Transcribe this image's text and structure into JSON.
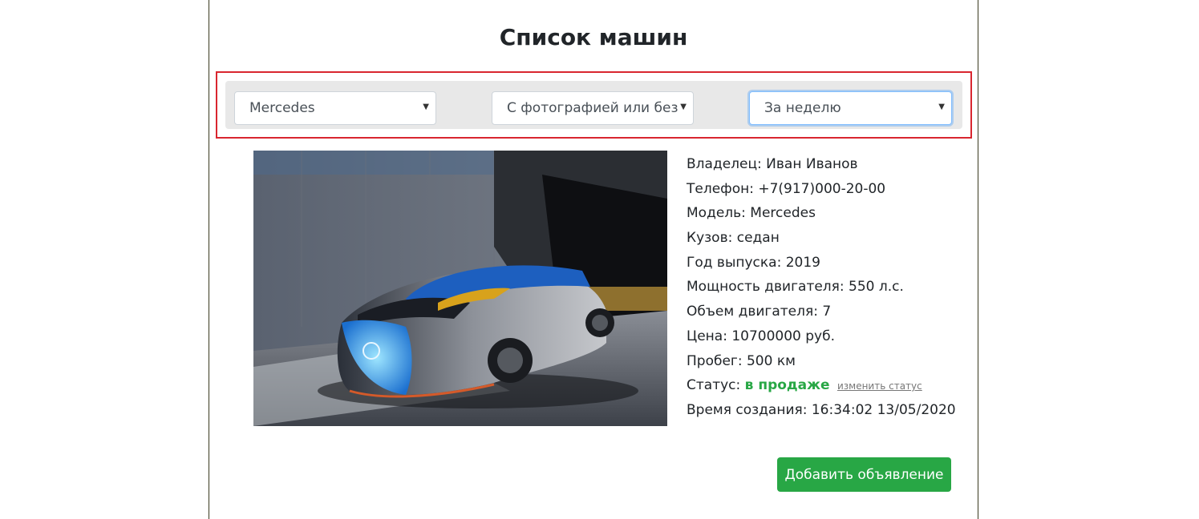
{
  "page": {
    "title": "Список машин"
  },
  "filters": {
    "brand": {
      "value": "Mercedes"
    },
    "photo": {
      "value": "С фотографией или без"
    },
    "period": {
      "value": "За неделю"
    }
  },
  "car": {
    "owner": "Владелец: Иван Иванов",
    "phone": "Телефон: +7(917)000-20-00",
    "model": "Модель: Mercedes",
    "body": "Кузов: седан",
    "year": "Год выпуска: 2019",
    "power": "Мощность двигателя: 550 л.с.",
    "volume": "Объем двигателя: 7",
    "price": "Цена: 10700000 руб.",
    "mileage": "Пробег: 500 км",
    "status_label": "Статус:",
    "status_value": "в продаже",
    "change_status": "изменить статус",
    "created": "Время создания: 16:34:02 13/05/2020"
  },
  "actions": {
    "add_label": "Добавить объявление"
  },
  "colors": {
    "accent_green": "#28a745",
    "highlight_red": "#d9262f",
    "panel_bg": "#e8e8e8"
  }
}
